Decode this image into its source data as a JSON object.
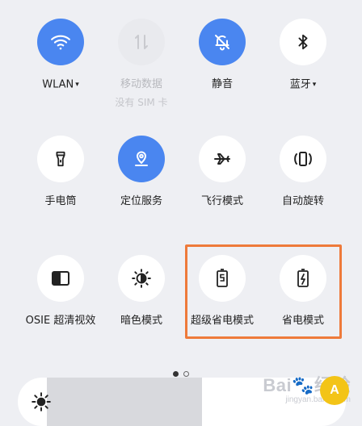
{
  "row1": [
    {
      "label": "WLAN",
      "dropdown": true,
      "state": "on",
      "icon": "wifi-icon"
    },
    {
      "label": "移动数据",
      "sub": "没有 SIM 卡",
      "state": "disabled",
      "icon": "mobile-data-icon"
    },
    {
      "label": "静音",
      "state": "on",
      "icon": "bell-off-icon"
    },
    {
      "label": "蓝牙",
      "dropdown": true,
      "state": "off",
      "icon": "bluetooth-icon"
    }
  ],
  "row2": [
    {
      "label": "手电筒",
      "state": "off",
      "icon": "flashlight-icon"
    },
    {
      "label": "定位服务",
      "state": "on",
      "icon": "location-icon"
    },
    {
      "label": "飞行模式",
      "state": "off",
      "icon": "airplane-icon"
    },
    {
      "label": "自动旋转",
      "state": "off",
      "icon": "auto-rotate-icon"
    }
  ],
  "row3": [
    {
      "label": "OSIE 超清视效",
      "state": "off",
      "icon": "display-enhance-icon"
    },
    {
      "label": "暗色模式",
      "state": "off",
      "icon": "dark-mode-icon"
    },
    {
      "label": "超级省电模式",
      "state": "off",
      "icon": "super-power-saving-icon"
    },
    {
      "label": "省电模式",
      "state": "off",
      "icon": "power-saving-icon"
    }
  ],
  "dropdown_caret": "▾",
  "pager": {
    "pages": 2,
    "current": 1
  },
  "brightness": {
    "level": 0.52,
    "icon": "brightness-icon"
  },
  "watermark": {
    "brand": "Bai",
    "suffix": "经验",
    "url": "jingyan.baidu.com",
    "badge": "A"
  },
  "colors": {
    "accent": "#4a86f0",
    "highlight": "#ee7a3a",
    "background": "#eeeff3"
  }
}
